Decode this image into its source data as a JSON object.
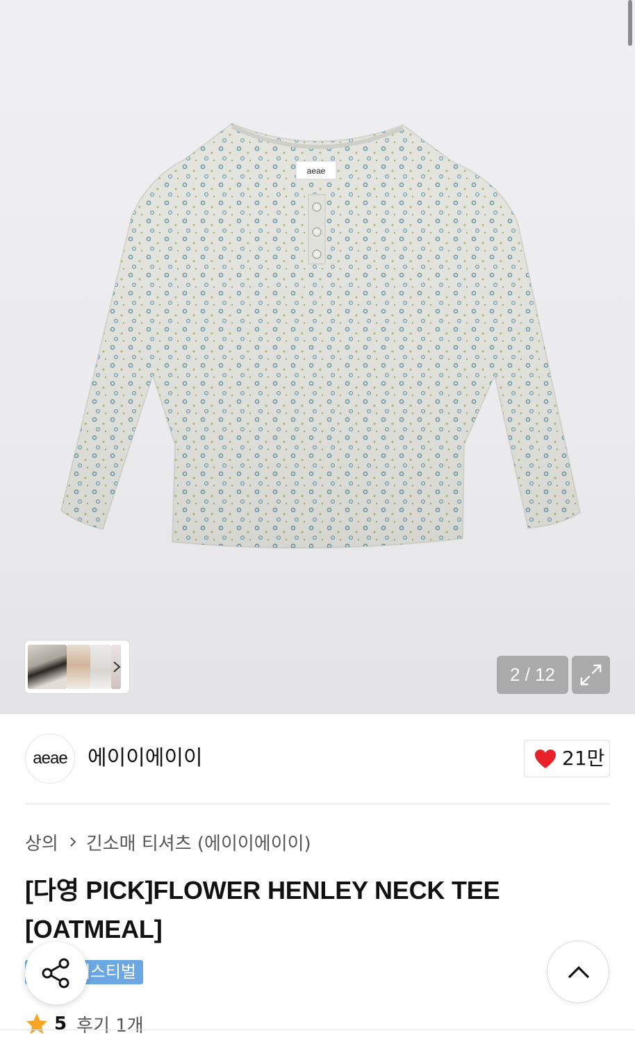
{
  "gallery": {
    "counter": "2 / 12",
    "expand_icon": "expand-icon",
    "thumbnail_more_icon": "chevron-right-icon",
    "label_tag": "aeae"
  },
  "brand": {
    "logo_text": "aeae",
    "name": "에이이에이이",
    "like_icon": "heart-icon",
    "like_color": "#e8202a",
    "like_count": "21만"
  },
  "breadcrumb": {
    "items": [
      "상의",
      "긴소매 티셔츠 (에이이에이이)"
    ]
  },
  "product": {
    "title": "[다영 PICK]FLOWER HENLEY NECK TEE [OATMEAL]",
    "badge": "페스티벌",
    "badge_color": "#6aa7e3",
    "rating": "5",
    "reviews": "후기 1개"
  },
  "floating": {
    "share_icon": "share-icon",
    "top_icon": "chevron-up-icon"
  }
}
